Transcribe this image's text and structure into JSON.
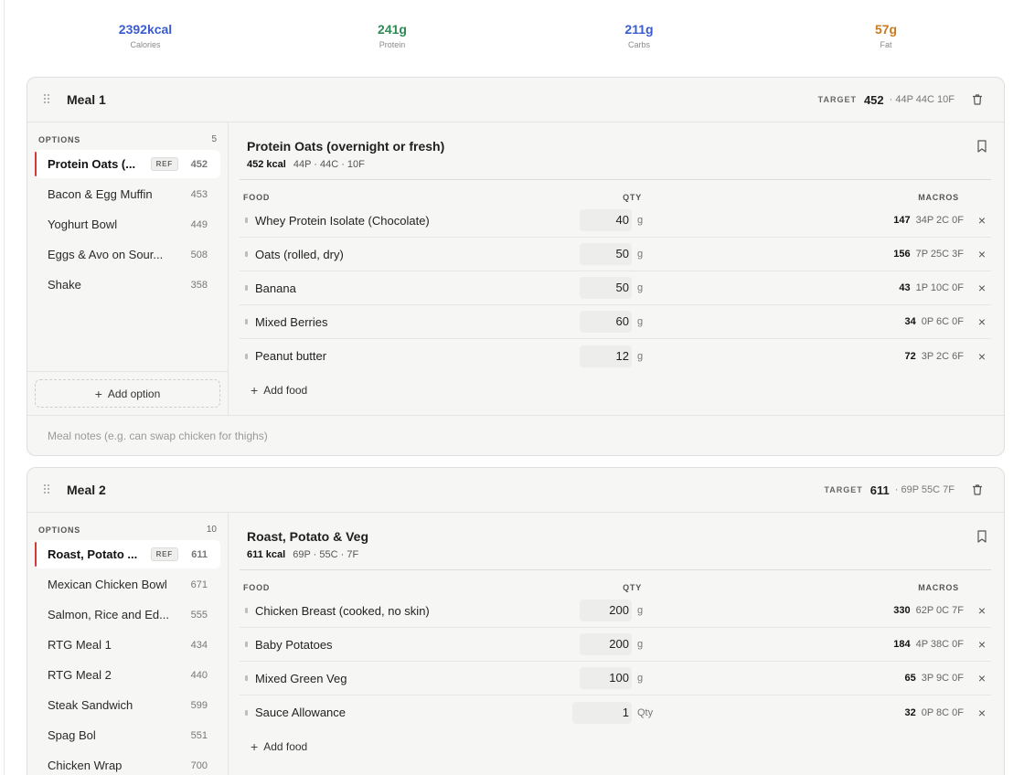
{
  "summary": [
    {
      "value": "2392kcal",
      "label": "Calories",
      "color": "#3a5bd0"
    },
    {
      "value": "241g",
      "label": "Protein",
      "color": "#2e8a55"
    },
    {
      "value": "211g",
      "label": "Carbs",
      "color": "#3a5bd0"
    },
    {
      "value": "57g",
      "label": "Fat",
      "color": "#c97a1e"
    }
  ],
  "labels": {
    "target": "TARGET",
    "options": "OPTIONS",
    "food": "FOOD",
    "qty": "QTY",
    "macros": "MACROS",
    "add_option": "Add option",
    "add_food": "Add food",
    "ref": "REF",
    "notes_placeholder": "Meal notes (e.g. can swap chicken for thighs)"
  },
  "meals": [
    {
      "title": "Meal 1",
      "target_kcal": "452",
      "target_macros": "· 44P  44C  10F",
      "options_count": "5",
      "options": [
        {
          "name": "Protein Oats (...",
          "kcal": "452",
          "ref": true
        },
        {
          "name": "Bacon & Egg Muffin",
          "kcal": "453"
        },
        {
          "name": "Yoghurt Bowl",
          "kcal": "449"
        },
        {
          "name": "Eggs & Avo on Sour...",
          "kcal": "508"
        },
        {
          "name": "Shake",
          "kcal": "358"
        }
      ],
      "detail": {
        "title": "Protein Oats (overnight or fresh)",
        "kcal": "452 kcal",
        "macros": "44P · 44C · 10F",
        "foods": [
          {
            "name": "Whey Protein Isolate (Chocolate)",
            "qty": "40",
            "unit": "g",
            "kcal": "147",
            "macros": "34P 2C 0F"
          },
          {
            "name": "Oats (rolled, dry)",
            "qty": "50",
            "unit": "g",
            "kcal": "156",
            "macros": "7P 25C 3F"
          },
          {
            "name": "Banana",
            "qty": "50",
            "unit": "g",
            "kcal": "43",
            "macros": "1P 10C 0F"
          },
          {
            "name": "Mixed Berries",
            "qty": "60",
            "unit": "g",
            "kcal": "34",
            "macros": "0P 6C 0F"
          },
          {
            "name": "Peanut butter",
            "qty": "12",
            "unit": "g",
            "kcal": "72",
            "macros": "3P 2C 6F"
          }
        ]
      }
    },
    {
      "title": "Meal 2",
      "target_kcal": "611",
      "target_macros": "· 69P  55C  7F",
      "options_count": "10",
      "options": [
        {
          "name": "Roast, Potato ...",
          "kcal": "611",
          "ref": true
        },
        {
          "name": "Mexican Chicken Bowl",
          "kcal": "671"
        },
        {
          "name": "Salmon, Rice and Ed...",
          "kcal": "555"
        },
        {
          "name": "RTG Meal 1",
          "kcal": "434"
        },
        {
          "name": "RTG Meal 2",
          "kcal": "440"
        },
        {
          "name": "Steak Sandwich",
          "kcal": "599"
        },
        {
          "name": "Spag Bol",
          "kcal": "551"
        },
        {
          "name": "Chicken Wrap",
          "kcal": "700"
        }
      ],
      "detail": {
        "title": "Roast, Potato & Veg",
        "kcal": "611 kcal",
        "macros": "69P · 55C · 7F",
        "foods": [
          {
            "name": "Chicken Breast (cooked, no skin)",
            "qty": "200",
            "unit": "g",
            "kcal": "330",
            "macros": "62P 0C 7F"
          },
          {
            "name": "Baby Potatoes",
            "qty": "200",
            "unit": "g",
            "kcal": "184",
            "macros": "4P 38C 0F"
          },
          {
            "name": "Mixed Green Veg",
            "qty": "100",
            "unit": "g",
            "kcal": "65",
            "macros": "3P 9C 0F"
          },
          {
            "name": "Sauce Allowance",
            "qty": "1",
            "unit": "Qty",
            "kcal": "32",
            "macros": "0P 8C 0F"
          }
        ]
      }
    }
  ]
}
